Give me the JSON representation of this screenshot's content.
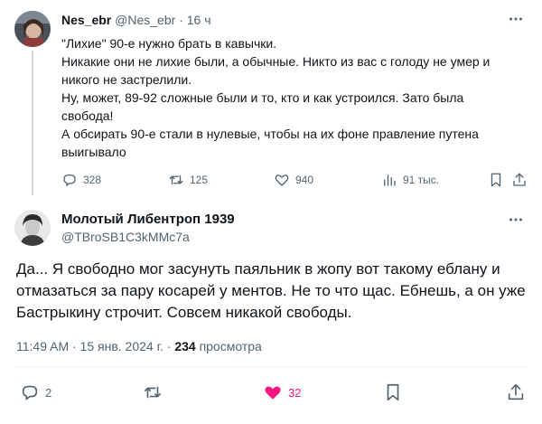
{
  "parent_tweet": {
    "author_name": "Nes_ebr",
    "handle": "@Nes_ebr",
    "separator": "·",
    "age": "16 ч",
    "lines": [
      "\"Лихие\" 90-е нужно брать в кавычки.",
      "Никакие они не лихие были, а обычные. Никто из вас с голоду не умер и",
      "никого не застрелили.",
      "Ну, может, 89-92 сложные были и то, кто и как устроился. Зато была",
      "свобода!",
      "А обсирать 90-е стали в нулевые, чтобы на их фоне правление путена",
      "выигывало"
    ],
    "replies": "328",
    "reposts": "125",
    "likes": "940",
    "views": "91 тыс."
  },
  "main_tweet": {
    "author_name": "Молотый Либентроп 1939",
    "handle": "@TBroSB1C3kMMc7a",
    "lines": [
      "Да... Я свободно мог засунуть паяльник в жопу вот такому еблану и",
      "отмазаться за пару косарей у ментов. Не то что щас. Ебнешь, а он уже",
      "Бастрыкину строчит. Совсем никакой свободы."
    ],
    "timestamp": "11:49 AM · 15 янв. 2024 г. ·",
    "views_count": "234",
    "views_label": "просмотра",
    "replies": "2",
    "likes": "32"
  },
  "colors": {
    "text": "#0f1419",
    "secondary": "#536471",
    "like_accent": "#f91880",
    "divider": "#eff3f4"
  },
  "icons": {
    "more": "more-horizontal-icon",
    "reply": "reply-icon",
    "repost": "repost-icon",
    "like": "heart-icon",
    "views": "views-bar-chart-icon",
    "bookmark": "bookmark-icon",
    "share": "share-icon"
  }
}
